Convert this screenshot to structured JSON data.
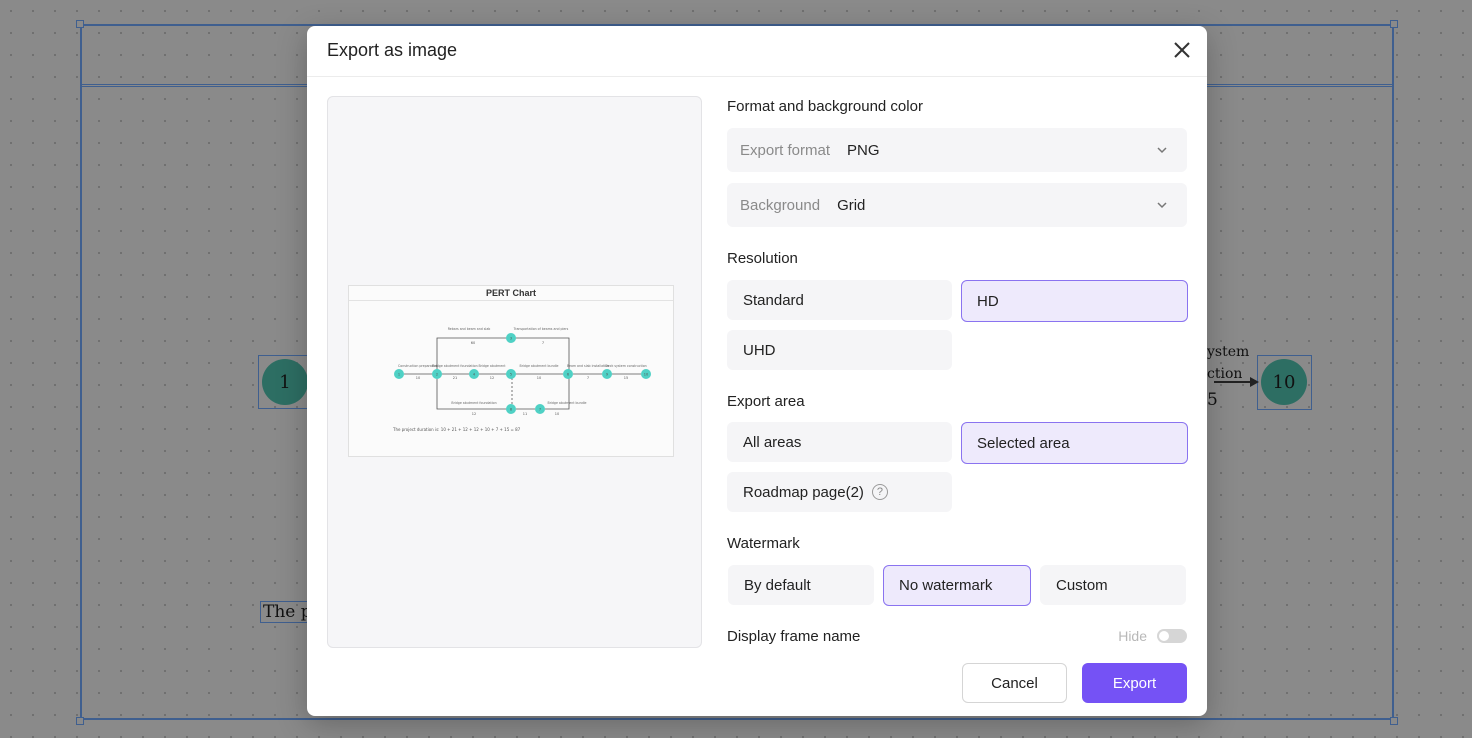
{
  "background": {
    "node_left": "1",
    "node_right": "10",
    "text_system": "ystem",
    "text_function": "ction",
    "text_duration": "5",
    "text_project": "The p"
  },
  "dialog": {
    "title": "Export as image",
    "preview": {
      "title": "PERT Chart",
      "nodes": [
        "1",
        "2",
        "4",
        "5",
        "3",
        "6",
        "9",
        "8",
        "7",
        "10"
      ],
      "edge_labels": [
        "Construction preparation",
        "Bridge abutment foundation",
        "Bridge abutment",
        "Bridge abutment bundle",
        "Rebars and beam and slab",
        "Transportation of beams and piers",
        "Beam and slab installation",
        "Deck system construction",
        "Bridge abutment foundation",
        "Bridge abutment bundle"
      ],
      "edge_durations": [
        "10",
        "21",
        "12",
        "10",
        "60",
        "7",
        "7",
        "15",
        "12",
        "11",
        "10"
      ],
      "formula": "The project duration is: 10 + 21 + 12 + 12 + 10 + 7 + 15 = 87"
    },
    "format_section": {
      "title": "Format and background color",
      "export_format_label": "Export format",
      "export_format_value": "PNG",
      "background_label": "Background",
      "background_value": "Grid"
    },
    "resolution": {
      "title": "Resolution",
      "options": [
        "Standard",
        "HD",
        "UHD"
      ],
      "selected": "HD"
    },
    "export_area": {
      "title": "Export area",
      "options": [
        "All areas",
        "Selected area",
        "Roadmap page(2)"
      ],
      "selected": "Selected area",
      "help_icon": "?"
    },
    "watermark": {
      "title": "Watermark",
      "options": [
        "By default",
        "No watermark",
        "Custom"
      ],
      "selected": "No watermark"
    },
    "frame_name": {
      "title": "Display frame name",
      "toggle_label": "Hide",
      "enabled": false
    },
    "buttons": {
      "cancel": "Cancel",
      "export": "Export"
    },
    "colors": {
      "accent": "#7552f5",
      "selected_bg": "#eeeafc",
      "node_teal": "#4fd1c5"
    }
  }
}
